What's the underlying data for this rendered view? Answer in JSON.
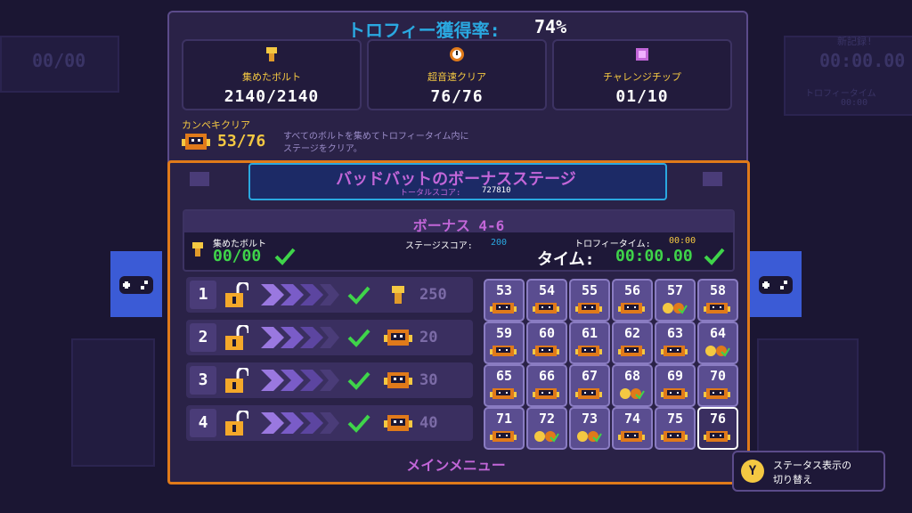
{
  "colors": {
    "accent_orange": "#e07a1a",
    "title_blue": "#2aa8e0",
    "bonus_pink": "#c266d8",
    "check_green": "#3fd44a",
    "gold": "#f4c842"
  },
  "trophy": {
    "title": "トロフィー獲得率:",
    "percent": "74%",
    "stats": [
      {
        "icon": "bolt-icon",
        "label": "集めたボルト",
        "value": "2140/2140"
      },
      {
        "icon": "clock-icon",
        "label": "超音速クリア",
        "value": "76/76"
      },
      {
        "icon": "chip-icon",
        "label": "チャレンジチップ",
        "value": "01/10"
      }
    ],
    "complete_label": "カンペキクリア",
    "complete_value": "53/76",
    "complete_desc_1": "すべてのボルトを集めてトロフィータイム内に",
    "complete_desc_2": "ステージをクリア。"
  },
  "bonus": {
    "title": "バッドバットのボーナスステージ",
    "total_score_label": "トータルスコア:",
    "total_score": "727810",
    "stage_name": "ボーナス 4-6",
    "collected_label": "集めたボルト",
    "collected_value": "00/00",
    "stage_score_label": "ステージスコア:",
    "stage_score": "200",
    "trophy_time_label": "トロフィータイム:",
    "trophy_time": "00:00",
    "time_label": "タイム:",
    "time_value": "00:00.00",
    "rows": [
      {
        "num": "1",
        "icon": "bolt-icon",
        "value": "250"
      },
      {
        "num": "2",
        "icon": "robot-icon",
        "value": "20"
      },
      {
        "num": "3",
        "icon": "robot-icon",
        "value": "30"
      },
      {
        "num": "4",
        "icon": "robot-icon",
        "value": "40"
      }
    ],
    "stages": [
      "53",
      "54",
      "55",
      "56",
      "57",
      "58",
      "59",
      "60",
      "61",
      "62",
      "63",
      "64",
      "65",
      "66",
      "67",
      "68",
      "69",
      "70",
      "71",
      "72",
      "73",
      "74",
      "75",
      "76"
    ],
    "stage_badges": [
      "robot",
      "robot",
      "robot",
      "robot",
      "medals",
      "robot",
      "robot",
      "robot",
      "robot",
      "robot",
      "robot",
      "medals",
      "robot",
      "robot",
      "robot",
      "medals",
      "robot",
      "robot",
      "robot",
      "medals",
      "medals",
      "robot",
      "robot",
      "robot"
    ],
    "selected_stage": "76",
    "main_menu": "メインメニュー"
  },
  "hint": {
    "button": "Y",
    "text_1": "ステータス表示の",
    "text_2": "切り替え"
  },
  "background": {
    "left_counter": "00/00",
    "right_title": "新記録!",
    "right_time": "00:00.00",
    "right_sub": "トロフィータイム",
    "right_sub_time": "00:00"
  }
}
